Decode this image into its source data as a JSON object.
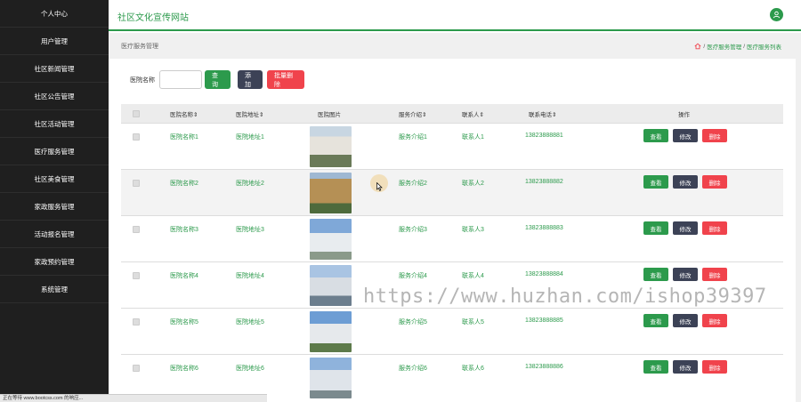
{
  "sidebar": {
    "items": [
      {
        "label": "个人中心"
      },
      {
        "label": "用户管理"
      },
      {
        "label": "社区新闻管理"
      },
      {
        "label": "社区公告管理"
      },
      {
        "label": "社区活动管理"
      },
      {
        "label": "医疗服务管理"
      },
      {
        "label": "社区美食管理"
      },
      {
        "label": "家政服务管理"
      },
      {
        "label": "活动报名管理"
      },
      {
        "label": "家政预约管理"
      },
      {
        "label": "系统管理"
      }
    ]
  },
  "header": {
    "site_title": "社区文化宣传网站",
    "user_icon": "user-icon"
  },
  "page": {
    "title": "医疗服务管理",
    "breadcrumb": [
      "医疗服务管理",
      "医疗服务列表"
    ],
    "breadcrumb_sep": "/"
  },
  "search": {
    "label": "医院名称",
    "value": "",
    "query_label": "查询",
    "add_label": "添加",
    "batch_delete_label": "批量删除"
  },
  "table": {
    "columns": [
      "医院名称⇕",
      "医院地址⇕",
      "医院图片",
      "服务介绍⇕",
      "联系人⇕",
      "联系电话⇕",
      "操作"
    ],
    "actions": {
      "view": "查看",
      "edit": "修改",
      "delete": "删除"
    },
    "rows": [
      {
        "name": "医院名称1",
        "address": "医院地址1",
        "intro": "服务介绍1",
        "contact": "联系人1",
        "phone": "13823888881"
      },
      {
        "name": "医院名称2",
        "address": "医院地址2",
        "intro": "服务介绍2",
        "contact": "联系人2",
        "phone": "13823888882"
      },
      {
        "name": "医院名称3",
        "address": "医院地址3",
        "intro": "服务介绍3",
        "contact": "联系人3",
        "phone": "13823888883"
      },
      {
        "name": "医院名称4",
        "address": "医院地址4",
        "intro": "服务介绍4",
        "contact": "联系人4",
        "phone": "13823888884"
      },
      {
        "name": "医院名称5",
        "address": "医院地址5",
        "intro": "服务介绍5",
        "contact": "联系人5",
        "phone": "13823888885"
      },
      {
        "name": "医院名称6",
        "address": "医院地址6",
        "intro": "服务介绍6",
        "contact": "联系人6",
        "phone": "13823888886"
      }
    ]
  },
  "watermark": "https://www.huzhan.com/ishop39397",
  "status_bar": "正在等待 www.bootcss.com 的响应...",
  "colors": {
    "accent": "#2c9a4c",
    "sidebar": "#1f1f1f",
    "danger": "#f0434c",
    "dark": "#3c4256"
  }
}
